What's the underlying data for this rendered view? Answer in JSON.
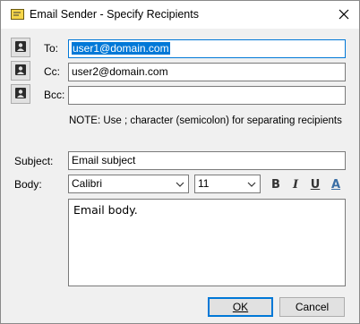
{
  "window": {
    "title": "Email Sender - Specify Recipients",
    "icon": "envelope-icon",
    "close_icon": "close-icon"
  },
  "recipients": {
    "to": {
      "label": "To:",
      "value": "user1@domain.com",
      "selected": true
    },
    "cc": {
      "label": "Cc:",
      "value": "user2@domain.com"
    },
    "bcc": {
      "label": "Bcc:",
      "value": ""
    },
    "button_icon": "address-book-contact-icon",
    "note": "NOTE: Use ; character (semicolon) for separating recipients"
  },
  "subject": {
    "label": "Subject:",
    "value": "Email subject"
  },
  "body": {
    "label": "Body:",
    "font": "Calibri",
    "size": "11",
    "format_buttons": [
      {
        "name": "bold",
        "glyph": "B"
      },
      {
        "name": "italic",
        "glyph": "I"
      },
      {
        "name": "underline",
        "glyph": "U"
      },
      {
        "name": "font-color",
        "glyph": "A",
        "color": "#3a6ea5"
      }
    ],
    "text": "Email body."
  },
  "buttons": {
    "ok": "OK",
    "cancel": "Cancel"
  },
  "colors": {
    "selection": "#0078d7",
    "dialog_bg": "#f0f0f0"
  }
}
